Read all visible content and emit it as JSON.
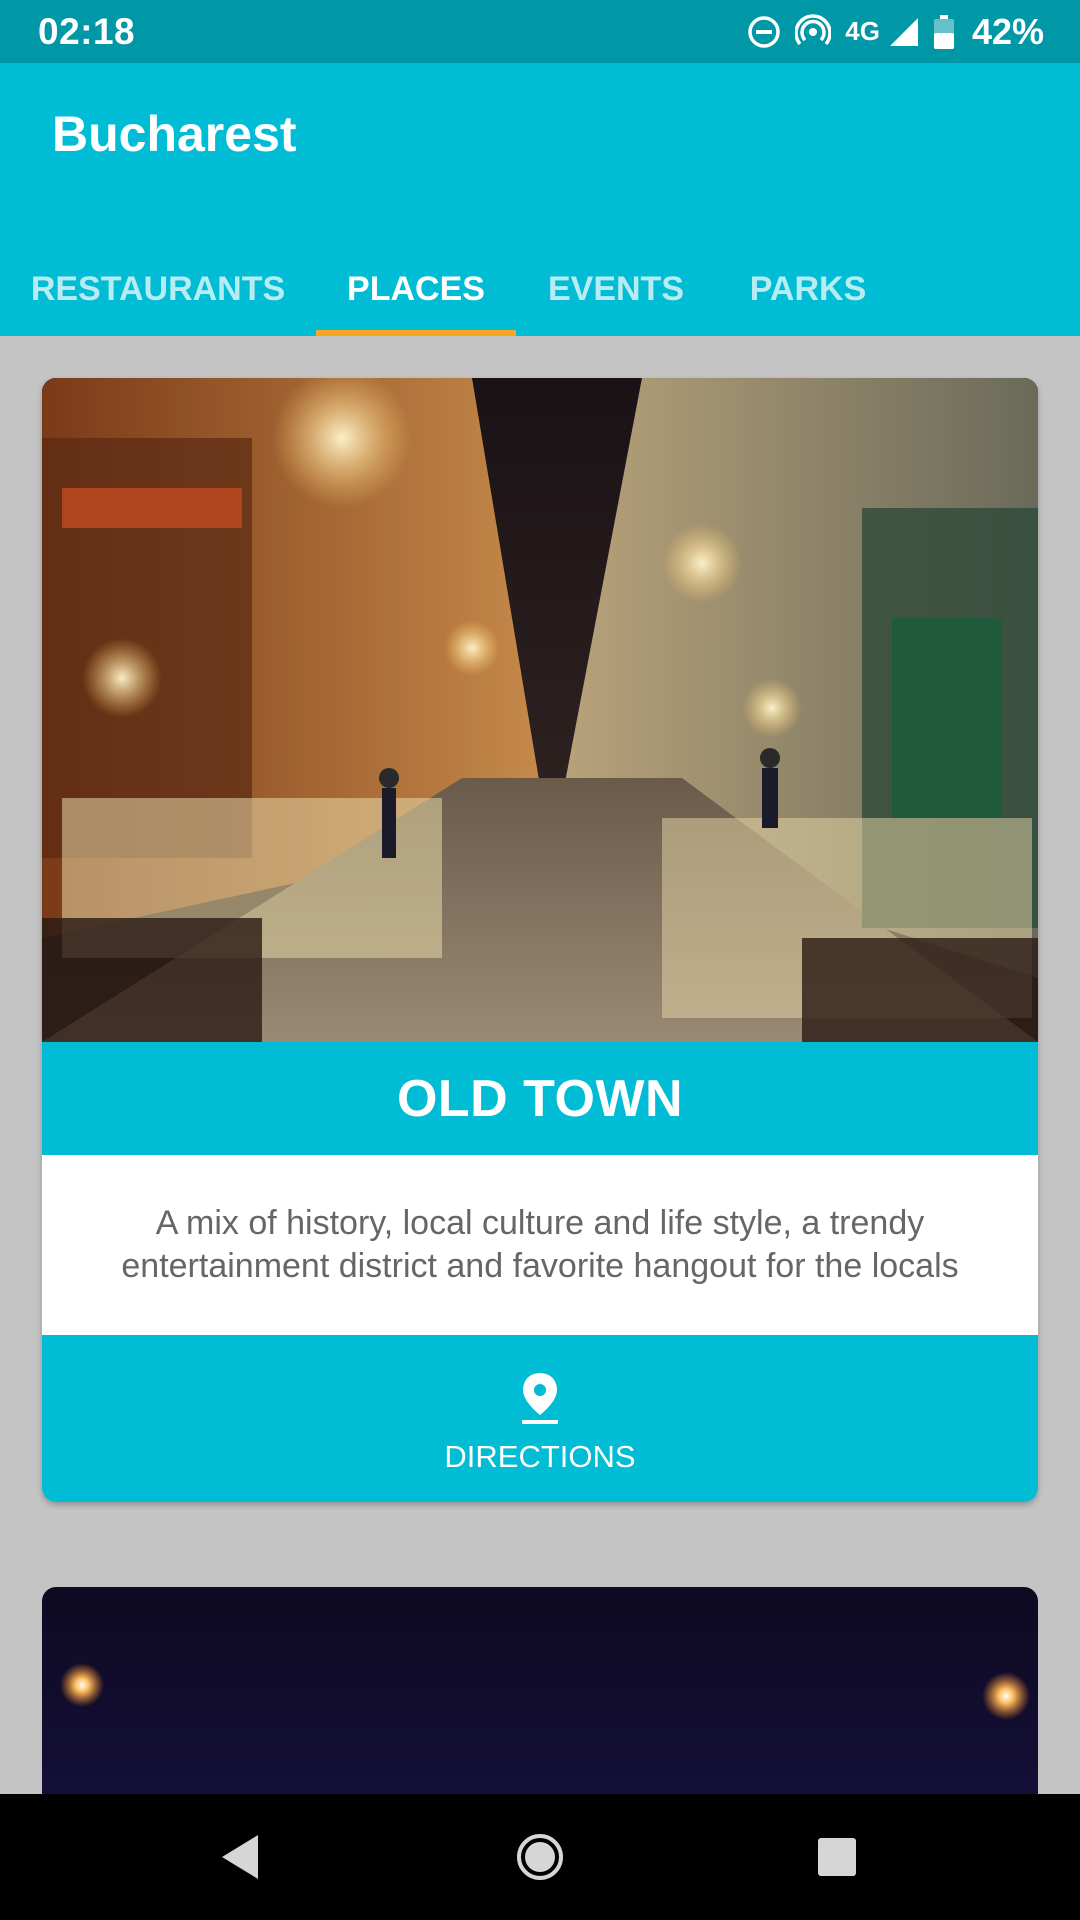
{
  "status_bar": {
    "time": "02:18",
    "network": "4G",
    "battery": "42%",
    "icons": [
      "do-not-disturb-icon",
      "hotspot-icon",
      "signal-icon",
      "battery-icon"
    ]
  },
  "app_bar": {
    "title": "Bucharest",
    "tabs": [
      {
        "label": "RESTAURANTS",
        "active": false
      },
      {
        "label": "PLACES",
        "active": true
      },
      {
        "label": "EVENTS",
        "active": false
      },
      {
        "label": "PARKS",
        "active": false
      }
    ]
  },
  "cards": [
    {
      "image": "old-town-night-street-photo",
      "title": "OLD TOWN",
      "description": "A mix of history, local culture and life style, a trendy entertainment district and favorite hangout for the locals",
      "action_label": "DIRECTIONS",
      "action_icon": "location-pin-icon"
    },
    {
      "image": "night-sky-lights-photo"
    }
  ],
  "nav_bar": {
    "buttons": [
      "back-icon",
      "home-icon",
      "recents-icon"
    ]
  },
  "colors": {
    "primary": "#00bcd4",
    "primary_dark": "#0097a7",
    "accent": "#f5a623",
    "background": "#c4c4c4"
  }
}
